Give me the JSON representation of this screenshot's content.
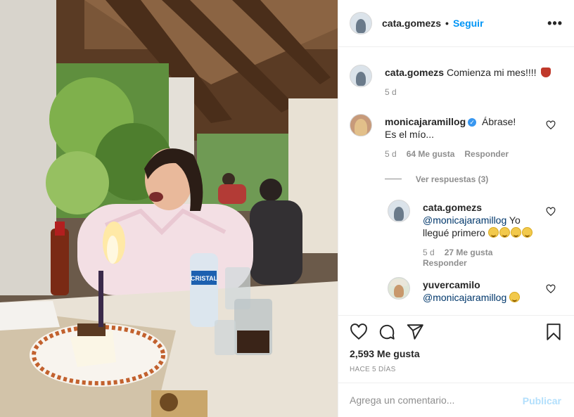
{
  "photo": {
    "alt_icon": "photo-birthday-cake-restaurant",
    "bottle_label": "CRISTAL"
  },
  "header": {
    "username": "cata.gomezs",
    "separator": "•",
    "follow_label": "Seguir",
    "more_icon": "more-horizontal-icon"
  },
  "caption": {
    "username": "cata.gomezs",
    "text": "Comienza mi mes!!!!",
    "time": "5 d"
  },
  "comments": [
    {
      "username": "monicajaramillog",
      "verified": true,
      "text": "Ábrase! Es el mío...",
      "time": "5 d",
      "likes": "64 Me gusta",
      "reply_label": "Responder"
    }
  ],
  "view_replies": "Ver respuestas (3)",
  "replies": [
    {
      "username": "cata.gomezs",
      "mention": "@monicajaramillog",
      "text": "Yo llegué primero",
      "time": "5 d",
      "likes": "27 Me gusta",
      "reply_label": "Responder"
    },
    {
      "username": "yuvercamilo",
      "mention": "@monicajaramillog",
      "text": ""
    }
  ],
  "actions": {
    "like_icon": "heart-icon",
    "comment_icon": "comment-icon",
    "share_icon": "share-icon",
    "save_icon": "bookmark-icon"
  },
  "likes_count": "2,593 Me gusta",
  "posted_ago": "HACE 5 DÍAS",
  "comment_box": {
    "placeholder": "Agrega un comentario...",
    "publish_label": "Publicar"
  },
  "colors": {
    "accent": "#0095f6",
    "publish_disabled": "#b2dffc",
    "muted": "#8e8e8e",
    "verified": "#3897f0"
  }
}
